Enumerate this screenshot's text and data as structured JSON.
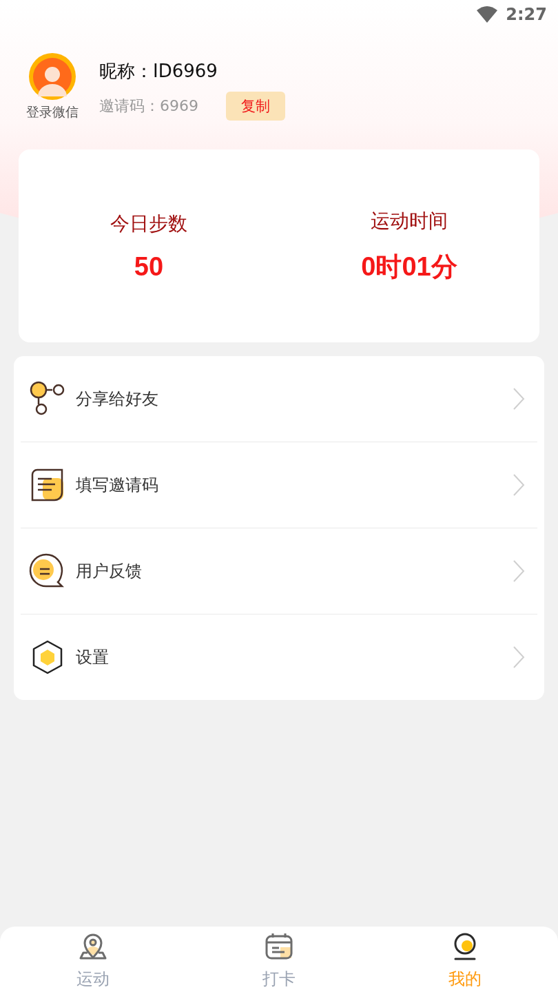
{
  "status_bar": {
    "time": "2:27"
  },
  "profile": {
    "login_label": "登录微信",
    "nickname": "昵称：ID6969",
    "invite_code": "邀请码：6969",
    "copy_button": "复制"
  },
  "stats": [
    {
      "label": "今日步数",
      "value": "50"
    },
    {
      "label": "运动时间",
      "value": "0时01分"
    }
  ],
  "menu": [
    {
      "label": "分享给好友"
    },
    {
      "label": "填写邀请码"
    },
    {
      "label": "用户反馈"
    },
    {
      "label": "设置"
    }
  ],
  "tabs": [
    {
      "label": "运动",
      "selected": false
    },
    {
      "label": "打卡",
      "selected": false
    },
    {
      "label": "我的",
      "selected": true
    }
  ]
}
